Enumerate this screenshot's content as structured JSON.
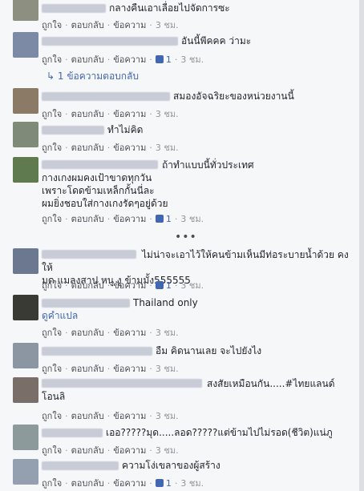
{
  "action_labels": {
    "like": "ถูกใจ",
    "reply": "ตอบกลับ",
    "message": "ข้อความ",
    "sep": "·"
  },
  "comments": [
    {
      "text": "กลางคืนเอาเลื่อยไปจัดการซะ",
      "time": "3 ชม.",
      "likes": ""
    },
    {
      "text": "อันนี้พีคคค ว่ามะ",
      "time": "3 ชม.",
      "likes": "1"
    },
    {
      "text": "สมองอัจฉริยะของหน่วยงานนี้",
      "time": "3 ชม.",
      "likes": ""
    },
    {
      "text": "ทำไม่คิด",
      "time": "3 ชม.",
      "likes": ""
    },
    {
      "text": "ถ้าทำแบบนี้ทั่วประเทศ\nกางเกงผมคงเป้าขาดทุกวัน\nเพราะโดดข้ามเหล็กกั้นนี่ละ\nผมยิ่งชอบใส่กางเกงรัดๆอยู่ด้วย",
      "time": "3 ชม.",
      "likes": "1"
    },
    {
      "text": "ไม่น่าจะเอาไว้ให้คนข้ามเห็นมีท่อระบายน้ำด้วย คงให้\nมด แมลงสาป หนู งู ข้ามมั้ง555555",
      "time": "3 ชม.",
      "likes": "1"
    },
    {
      "text": "Thailand only",
      "translate": "ดูคำแปล",
      "time": "3 ชม.",
      "likes": ""
    },
    {
      "text": "อืม คิดนานเลย จะไปยังไง",
      "time": "3 ชม.",
      "likes": ""
    },
    {
      "text": "สงสัยเหมือนกัน.....#ไทยแลนด์\nโอนลิ",
      "time": "3 ชม.",
      "likes": ""
    },
    {
      "text": "เออ?????มุด.....ลอด?????แต่ข้ามไปไม่รอด(ชีวิต)แน่ภู",
      "time": "3 ชม.",
      "likes": ""
    },
    {
      "text": "ความโง่เขลาของผู้สร้าง",
      "time": "3 ชม.",
      "likes": "1"
    }
  ],
  "replies_link": "1 ข้อความตอบกลับ",
  "more_indicator": "•••"
}
